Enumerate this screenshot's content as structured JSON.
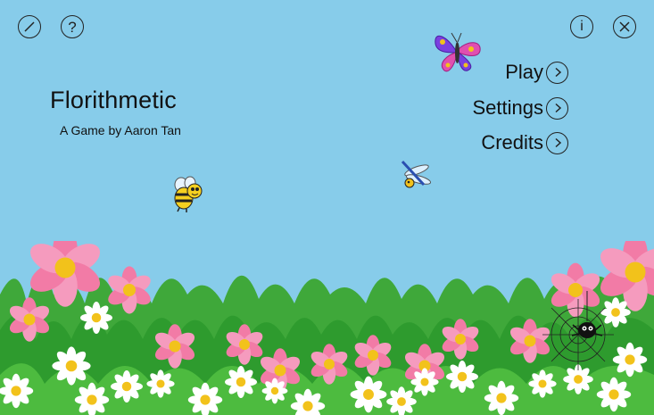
{
  "game": {
    "title": "Florithmetic",
    "subtitle": "A Game by Aaron Tan"
  },
  "toolbar": {
    "edit_icon": "slash-circle-icon",
    "help_label": "?",
    "info_label": "i",
    "close_icon": "x-circle-icon"
  },
  "menu": {
    "items": [
      {
        "label": "Play",
        "icon": "chevron-right-icon"
      },
      {
        "label": "Settings",
        "icon": "chevron-right-icon"
      },
      {
        "label": "Credits",
        "icon": "chevron-right-icon"
      }
    ]
  },
  "colors": {
    "sky": "#87CCEA",
    "grass": "#2E9B2E",
    "flower_pink": "#F27BA6",
    "flower_white": "#FFFFFF",
    "flower_center": "#F2C21B"
  },
  "sprites": [
    "butterfly",
    "bee",
    "dragonfly",
    "spider",
    "spider-web"
  ]
}
